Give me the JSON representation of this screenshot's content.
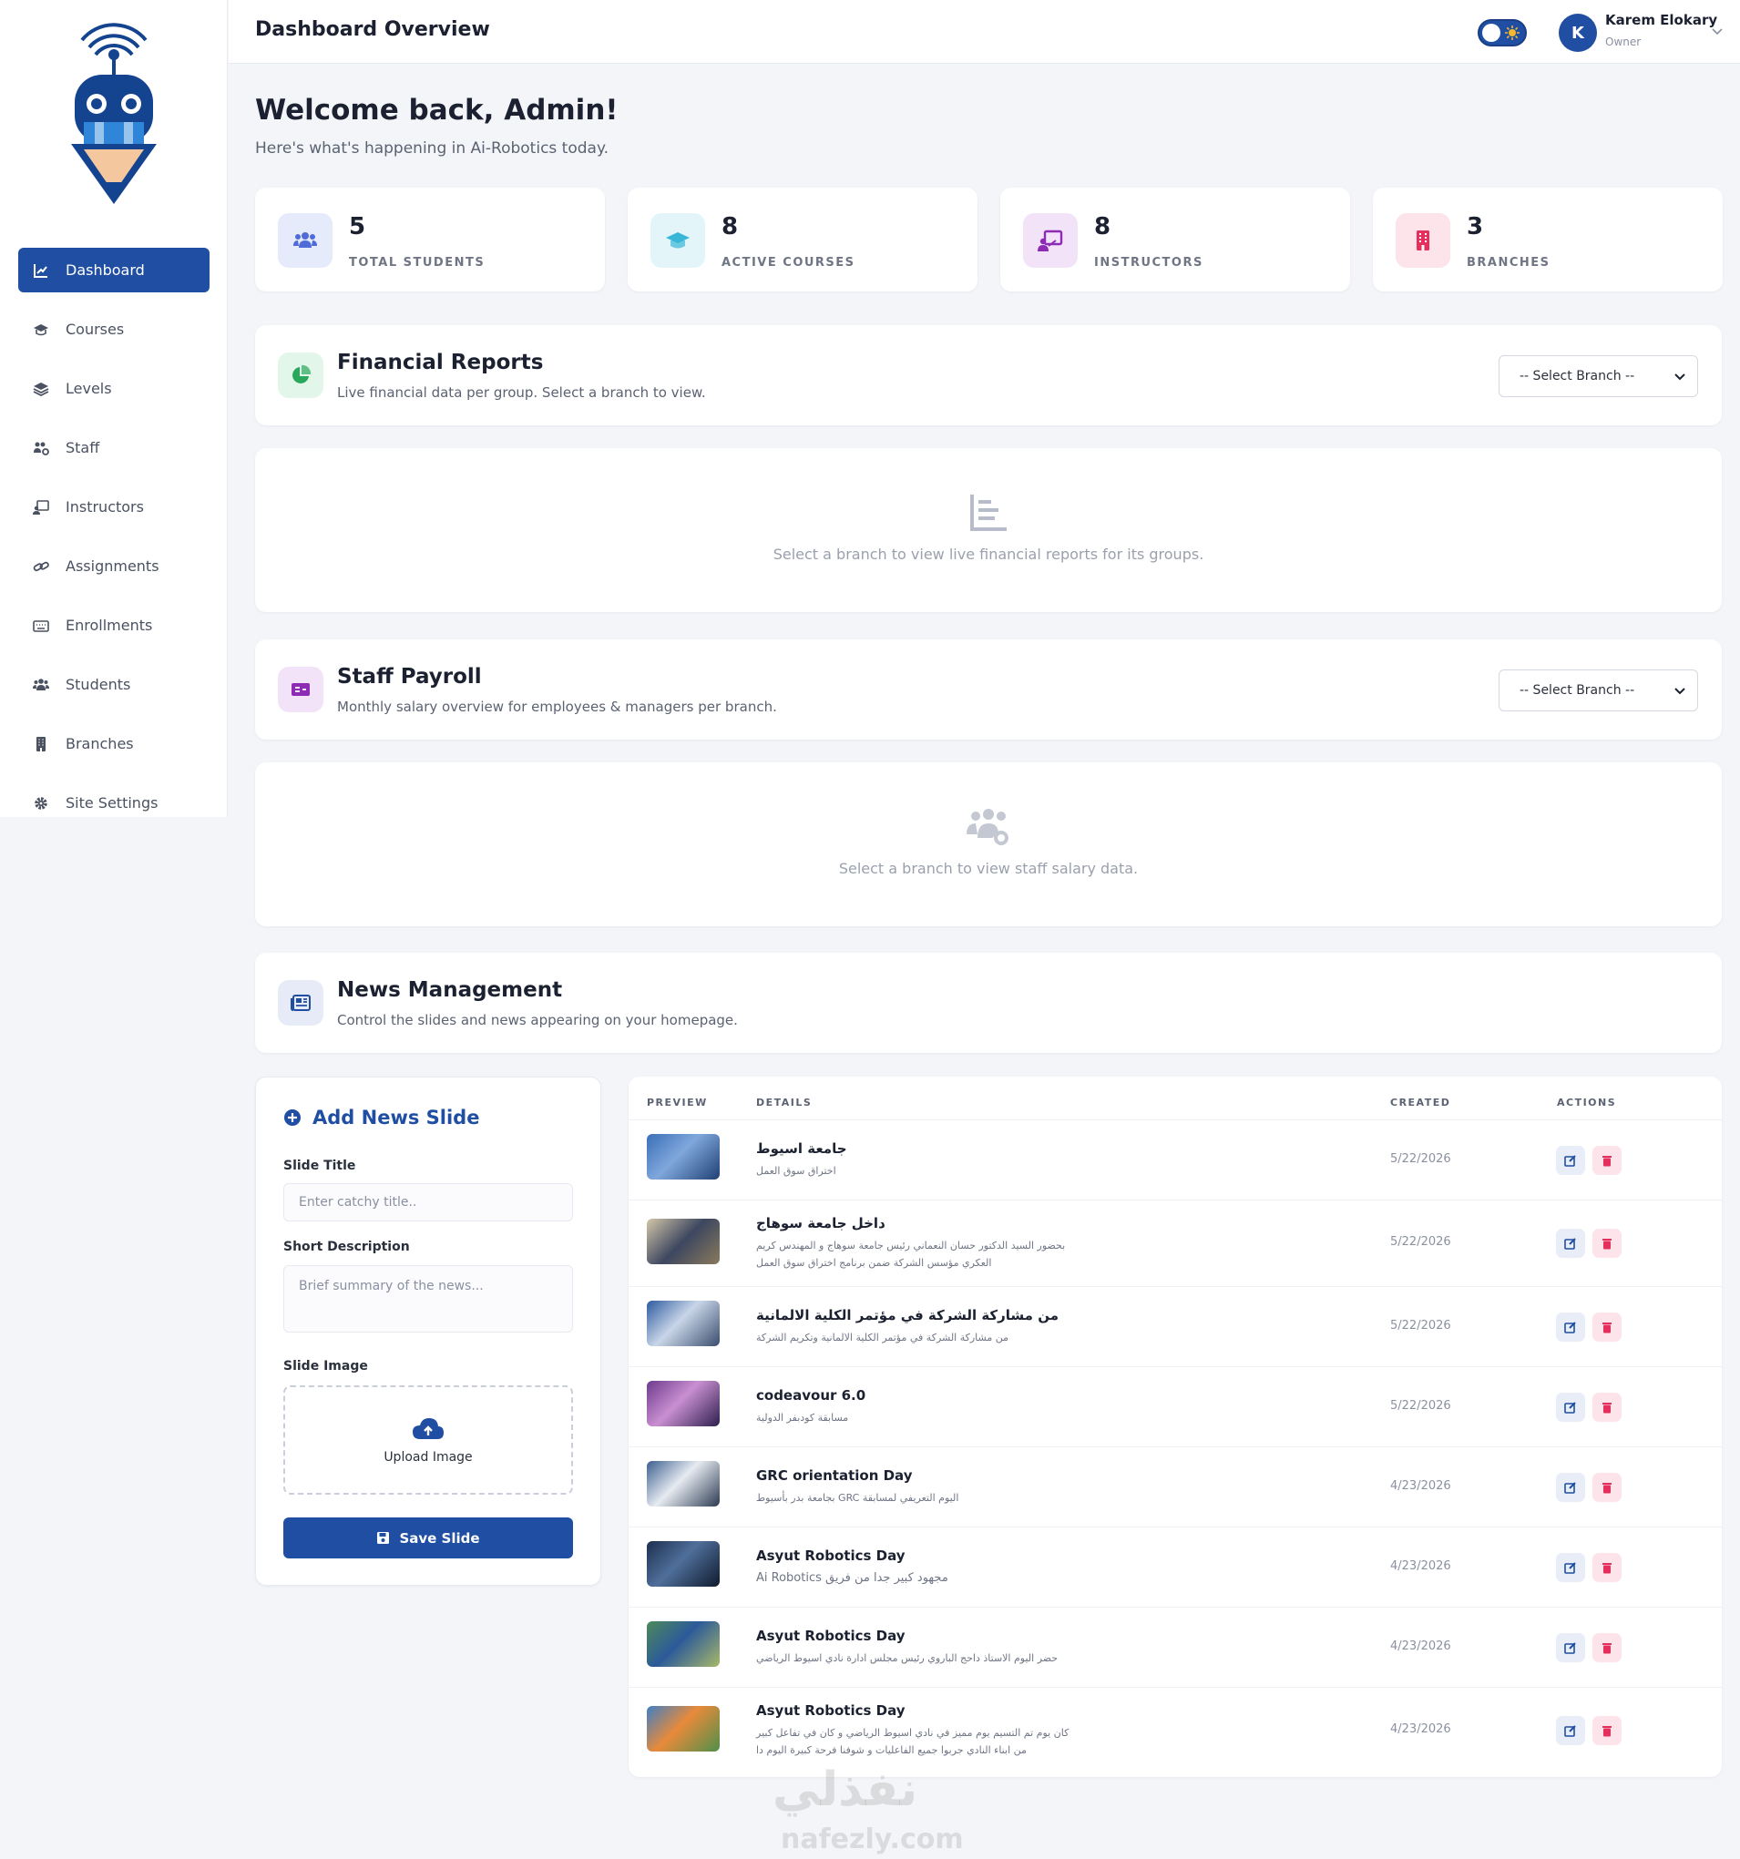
{
  "sidebar": {
    "items": [
      {
        "label": "Dashboard",
        "icon": "chart-line-icon"
      },
      {
        "label": "Courses",
        "icon": "graduation-cap-icon"
      },
      {
        "label": "Levels",
        "icon": "layers-icon"
      },
      {
        "label": "Staff",
        "icon": "users-cog-icon"
      },
      {
        "label": "Instructors",
        "icon": "chalkboard-teacher-icon"
      },
      {
        "label": "Assignments",
        "icon": "link-icon"
      },
      {
        "label": "Enrollments",
        "icon": "keyboard-icon"
      },
      {
        "label": "Students",
        "icon": "users-icon"
      },
      {
        "label": "Branches",
        "icon": "building-icon"
      },
      {
        "label": "Site Settings",
        "icon": "gear-icon"
      }
    ]
  },
  "header": {
    "title": "Dashboard Overview",
    "user": {
      "initial": "K",
      "name": "Karem Elokary",
      "role": "Owner"
    }
  },
  "welcome": {
    "title": "Welcome back, Admin!",
    "subtitle": "Here's what's happening in Ai-Robotics today."
  },
  "stats": [
    {
      "value": "5",
      "label": "TOTAL STUDENTS",
      "color": "#4f6bd8",
      "bg": "#e6ebfb"
    },
    {
      "value": "8",
      "label": "ACTIVE COURSES",
      "color": "#38b6d6",
      "bg": "#e4f5fa"
    },
    {
      "value": "8",
      "label": "INSTRUCTORS",
      "color": "#8e2bb5",
      "bg": "#f3e3f8"
    },
    {
      "value": "3",
      "label": "BRANCHES",
      "color": "#e5305e",
      "bg": "#fde3ea"
    }
  ],
  "financial": {
    "title": "Financial Reports",
    "subtitle": "Live financial data per group. Select a branch to view.",
    "select": "-- Select Branch --",
    "empty": "Select a branch to view live financial reports for its groups."
  },
  "payroll": {
    "title": "Staff Payroll",
    "subtitle": "Monthly salary overview for employees & managers per branch.",
    "select": "-- Select Branch --",
    "empty": "Select a branch to view staff salary data."
  },
  "news": {
    "title": "News Management",
    "subtitle": "Control the slides and news appearing on your homepage."
  },
  "form": {
    "title": "Add News Slide",
    "title_label": "Slide Title",
    "title_placeholder": "Enter catchy title..",
    "desc_label": "Short Description",
    "desc_placeholder": "Brief summary of the news...",
    "image_label": "Slide Image",
    "upload": "Upload Image",
    "save": "Save Slide"
  },
  "table": {
    "headers": [
      "PREVIEW",
      "DETAILS",
      "CREATED",
      "ACTIONS"
    ],
    "rows": [
      {
        "title": "جامعة اسيوط",
        "desc": "اختراق سوق العمل",
        "date": "5/22/2026"
      },
      {
        "title": "داخل جامعة سوهاج",
        "desc": "بحضور السيد الدكتور حسان النعماني رئيس جامعة سوهاج و المهندس كريم العكري مؤسس الشركة ضمن برنامج اختراق سوق العمل",
        "date": "5/22/2026"
      },
      {
        "title": "من مشاركة الشركة في مؤتمر الكلية الالمانية",
        "desc": "من مشاركة الشركة في مؤتمر الكلية الالمانية وتكريم الشركة",
        "date": "5/22/2026"
      },
      {
        "title": "codeavour 6.0",
        "desc": "مسابقة كودبفر الدولية",
        "date": "5/22/2026"
      },
      {
        "title": "GRC orientation Day",
        "desc": "بجامعة بدر بأسيوط GRC اليوم التعريفي لمسابقة",
        "date": "4/23/2026"
      },
      {
        "title": "Asyut Robotics Day",
        "desc": "Ai Robotics مجهود كبير جدا من فريق",
        "date": "4/23/2026"
      },
      {
        "title": "Asyut Robotics Day",
        "desc": "حضر اليوم الاستاذ داحج الباروي رئيس مجلس ادارة نادي اسيوط الرياضي",
        "date": "4/23/2026"
      },
      {
        "title": "Asyut Robotics Day",
        "desc": "كان يوم تم التسيم يوم مميز في نادي اسيوط الرياضي و كان في تفاعل كبير من ابناء النادي جربوا جميع الفاعليات و شوفنا فرحة كبيرة اليوم دا",
        "date": "4/23/2026"
      }
    ]
  },
  "watermark": {
    "arabic": "نفذلي",
    "latin": "nafezly.com"
  }
}
